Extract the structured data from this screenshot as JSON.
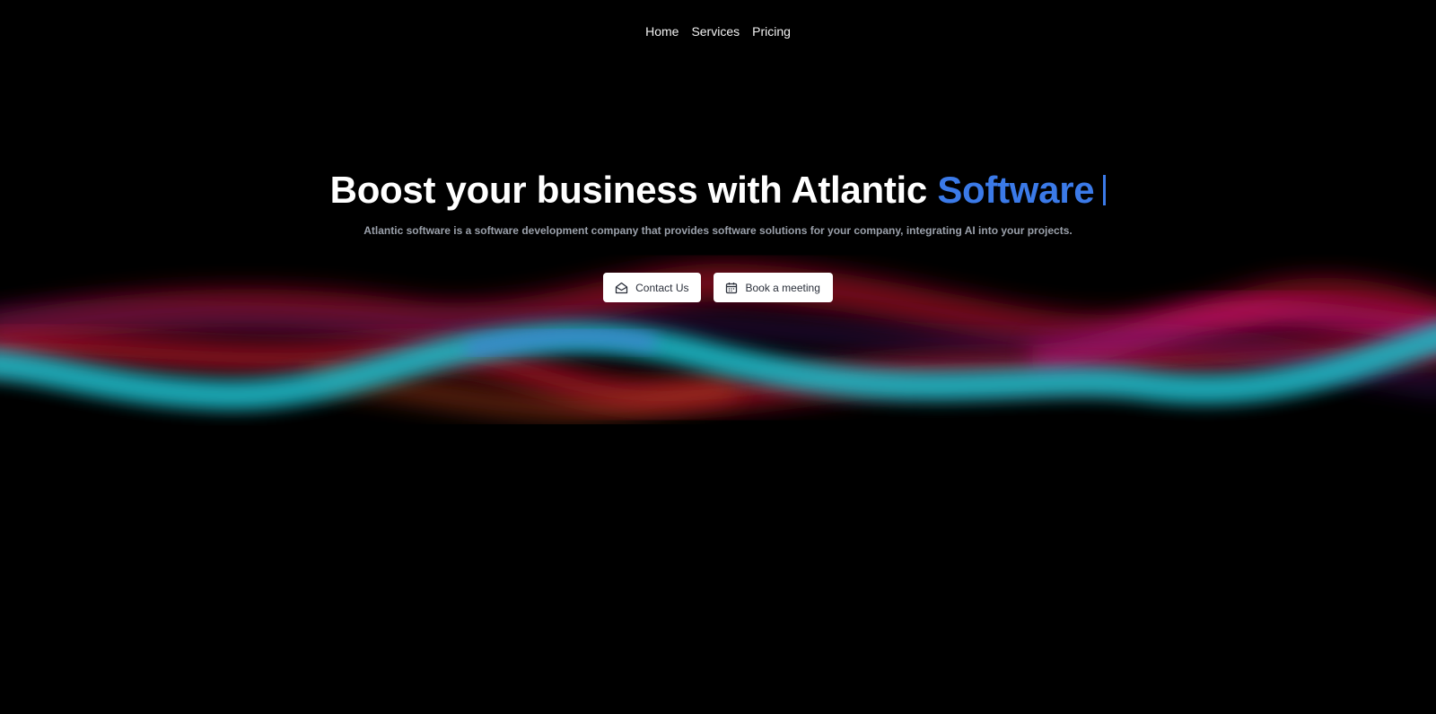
{
  "nav": {
    "items": [
      {
        "label": "Home"
      },
      {
        "label": "Services"
      },
      {
        "label": "Pricing"
      }
    ]
  },
  "hero": {
    "headline_main": "Boost your business with Atlantic ",
    "headline_accent": "Software",
    "subtitle": "Atlantic software is a software development company that provides software solutions for your company, integrating AI into your projects."
  },
  "buttons": {
    "contact": {
      "label": "Contact Us",
      "icon": "envelope-icon"
    },
    "meeting": {
      "label": "Book a meeting",
      "icon": "calendar-icon"
    }
  },
  "colors": {
    "background": "#000000",
    "accent": "#3b7ae8",
    "subtitle": "#9aa0aa",
    "button_bg": "#ffffff",
    "wave_cyan": "#1fb6c4",
    "wave_red": "#c0102a",
    "wave_magenta": "#d0107a"
  }
}
